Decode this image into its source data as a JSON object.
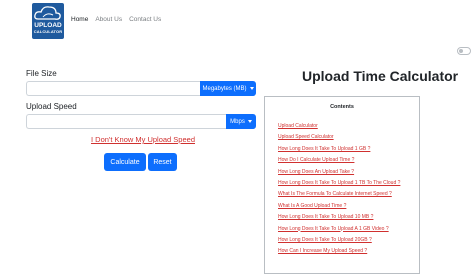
{
  "logo": {
    "line1": "UPLOAD",
    "line2": "CALCULATOR"
  },
  "nav": {
    "items": [
      "Home",
      "About Us",
      "Contact Us"
    ]
  },
  "form": {
    "file_size_label": "File Size",
    "file_size_value": "",
    "file_size_unit": "Megabytes (MB)",
    "upload_speed_label": "Upload Speed",
    "upload_speed_value": "",
    "upload_speed_unit": "Mbps",
    "dont_know_link": "I Don't Know My Upload Speed",
    "calculate_label": "Calculate",
    "reset_label": "Reset"
  },
  "page_title": "Upload Time Calculator",
  "contents": {
    "title": "Contents",
    "items": [
      "Upload Calculator",
      "Upload Speed Calculator",
      "How Long Does It Take To Upload 1 GB ?",
      "How Do I Calculate Upload Time ?",
      "How Long Does An Upload Take ?",
      "How Long Does It Take To Upload 1 TB To The Cloud ?",
      "What Is The Formula To Calculate Internet Speed ?",
      "What Is A Good Upload Time ?",
      "How Long Does It Take To Upload 10 MB ?",
      "How Long Does It Take To Upload A 1 GB Video ?",
      "How Long Does It Take To Upload 20GB ?",
      "How Can I Increase My Upload Speed ?"
    ]
  },
  "colors": {
    "primary": "#0d6efd",
    "link": "#d0302f",
    "logo_bg": "#1f5a9e"
  }
}
